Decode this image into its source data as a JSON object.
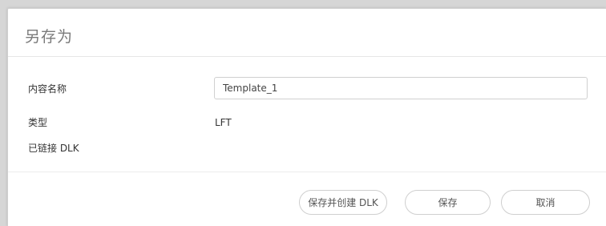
{
  "dialog": {
    "title": "另存为"
  },
  "form": {
    "content_name_label": "内容名称",
    "content_name_value": "Template_1",
    "type_label": "类型",
    "type_value": "LFT",
    "linked_dlk_label": "已链接 DLK"
  },
  "buttons": {
    "save_and_create_dlk": "保存并创建 DLK",
    "save": "保存",
    "cancel": "取消"
  }
}
